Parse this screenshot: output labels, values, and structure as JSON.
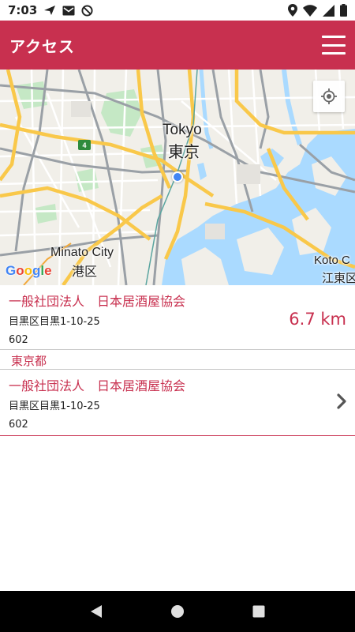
{
  "status_bar": {
    "time": "7:03",
    "left_icons": [
      "send-icon",
      "mail-icon",
      "block-icon"
    ],
    "right_icons": [
      "location-icon",
      "wifi-icon",
      "signal-icon",
      "battery-icon"
    ]
  },
  "app_bar": {
    "title": "アクセス",
    "color": "#c8304f",
    "menu_icon": "hamburger-menu-icon"
  },
  "map": {
    "labels": {
      "tokyo_en": "Tokyo",
      "tokyo_jp": "東京",
      "minato_en": "Minato City",
      "minato_jp": "港区",
      "koto_en": "Koto C",
      "koto_jp": "江東区"
    },
    "route_badge": "4",
    "google_logo": [
      "G",
      "o",
      "o",
      "g",
      "l",
      "e"
    ],
    "locate_icon": "my-location-icon"
  },
  "list": {
    "first_entry": {
      "name": "一般社団法人　日本居酒屋協会",
      "address": "目黒区目黒1-10-25",
      "code": "602",
      "distance": "6.7 km"
    },
    "section_title": "東京都",
    "second_entry": {
      "name": "一般社団法人　日本居酒屋協会",
      "address": "目黒区目黒1-10-25",
      "code": "602",
      "chevron_icon": "chevron-right-icon"
    }
  },
  "nav_bar": {
    "buttons": [
      "back-icon",
      "home-icon",
      "recents-icon"
    ]
  }
}
